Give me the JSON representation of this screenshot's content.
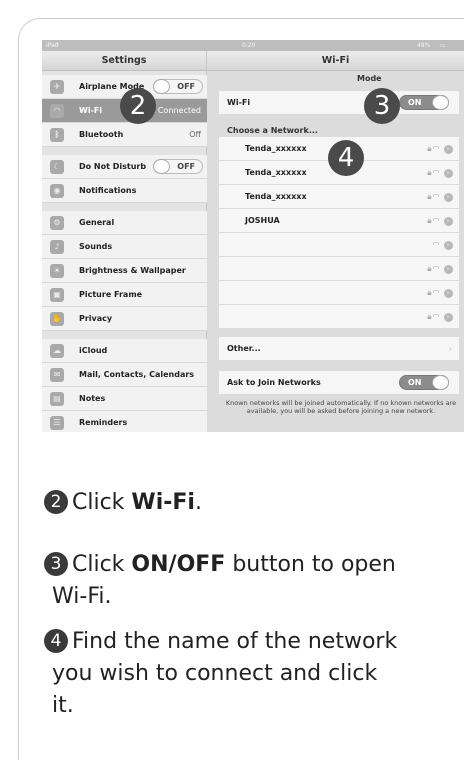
{
  "status": {
    "left": "iPad ",
    "time": "0:20",
    "battery": "48%"
  },
  "settings_panel": {
    "title": "Settings",
    "items": [
      {
        "label": "Airplane Mode",
        "toggle": "OFF",
        "icon": "airplane-icon"
      },
      {
        "label": "Wi-Fi",
        "value": "Not Connected",
        "icon": "wifi-icon"
      },
      {
        "label": "Bluetooth",
        "value": "Off",
        "icon": "bluetooth-icon"
      },
      {
        "label": "Do Not Disturb",
        "toggle": "OFF",
        "icon": "moon-icon"
      },
      {
        "label": "Notifications",
        "icon": "notifications-icon"
      },
      {
        "label": "General",
        "icon": "gear-icon"
      },
      {
        "label": "Sounds",
        "icon": "speaker-icon"
      },
      {
        "label": "Brightness & Wallpaper",
        "icon": "brightness-icon"
      },
      {
        "label": "Picture Frame",
        "icon": "picture-frame-icon"
      },
      {
        "label": "Privacy",
        "icon": "hand-icon"
      },
      {
        "label": "iCloud",
        "icon": "cloud-icon"
      },
      {
        "label": "Mail, Contacts, Calendars",
        "icon": "mail-icon"
      },
      {
        "label": "Notes",
        "icon": "notes-icon"
      },
      {
        "label": "Reminders",
        "icon": "reminders-icon"
      }
    ]
  },
  "wifi_panel": {
    "title": "Wi-Fi",
    "mode_label": "Mode",
    "wifi_label": "Wi-Fi",
    "wifi_toggle": "ON",
    "choose_label": "Choose a Network...",
    "networks": [
      "Tenda_xxxxxx",
      "Tenda_xxxxxx",
      "Tenda_xxxxxx",
      "JOSHUA",
      "",
      "",
      "",
      ""
    ],
    "other_label": "Other...",
    "ask_label": "Ask to Join Networks",
    "ask_toggle": "ON",
    "ask_note": "Known networks will be joined automatically. If no known networks are available, you will be asked before joining a new network."
  },
  "badges": [
    "2",
    "3",
    "4"
  ],
  "steps": [
    {
      "num": "2",
      "pre": "Click ",
      "bold": "Wi-Fi",
      "post": "."
    },
    {
      "num": "3",
      "pre": "Click ",
      "bold": "ON/OFF",
      "post": " button to open",
      "line2": "Wi-Fi."
    },
    {
      "num": "4",
      "pre": "Find the name of the network",
      "line2": "you wish to connect and click",
      "line3": "it."
    }
  ]
}
